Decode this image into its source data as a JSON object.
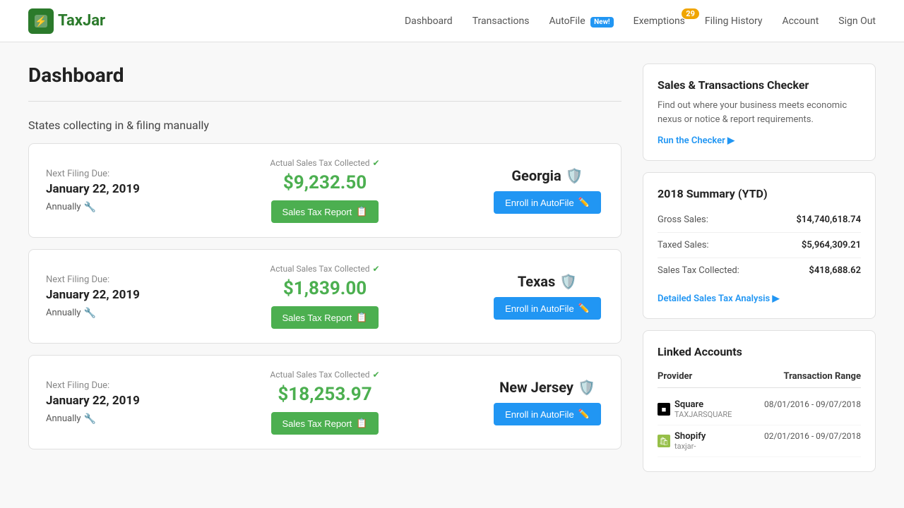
{
  "header": {
    "logo_text": "TaxJar",
    "logo_trademark": "®",
    "nav": {
      "items": [
        {
          "label": "Dashboard",
          "id": "dashboard",
          "badge": null,
          "new_badge": null
        },
        {
          "label": "Transactions",
          "id": "transactions",
          "badge": null,
          "new_badge": null
        },
        {
          "label": "AutoFile",
          "id": "autofile",
          "badge": null,
          "new_badge": "New!"
        },
        {
          "label": "Exemptions",
          "id": "exemptions",
          "badge": "29",
          "new_badge": null
        },
        {
          "label": "Filing History",
          "id": "filing-history",
          "badge": null,
          "new_badge": null
        },
        {
          "label": "Account",
          "id": "account",
          "badge": null,
          "new_badge": null
        },
        {
          "label": "Sign Out",
          "id": "sign-out",
          "badge": null,
          "new_badge": null
        }
      ]
    }
  },
  "main": {
    "title": "Dashboard",
    "section_title": "States collecting in & filing manually"
  },
  "state_cards": [
    {
      "id": "georgia",
      "next_filing_label": "Next Filing Due:",
      "next_filing_date": "January 22, 2019",
      "frequency": "Annually",
      "collected_label": "Actual Sales Tax Collected",
      "collected_amount": "$9,232.50",
      "report_btn": "Sales Tax Report",
      "state_name": "Georgia",
      "autofile_btn": "Enroll in AutoFile"
    },
    {
      "id": "texas",
      "next_filing_label": "Next Filing Due:",
      "next_filing_date": "January 22, 2019",
      "frequency": "Annually",
      "collected_label": "Actual Sales Tax Collected",
      "collected_amount": "$1,839.00",
      "report_btn": "Sales Tax Report",
      "state_name": "Texas",
      "autofile_btn": "Enroll in AutoFile"
    },
    {
      "id": "new-jersey",
      "next_filing_label": "Next Filing Due:",
      "next_filing_date": "January 22, 2019",
      "frequency": "Annually",
      "collected_label": "Actual Sales Tax Collected",
      "collected_amount": "$18,253.97",
      "report_btn": "Sales Tax Report",
      "state_name": "New Jersey",
      "autofile_btn": "Enroll in AutoFile"
    }
  ],
  "sidebar": {
    "checker": {
      "title": "Sales & Transactions Checker",
      "description": "Find out where your business meets economic nexus or notice & report requirements.",
      "link": "Run the Checker ▶"
    },
    "summary": {
      "title": "2018 Summary (YTD)",
      "rows": [
        {
          "label": "Gross Sales:",
          "value": "$14,740,618.74"
        },
        {
          "label": "Taxed Sales:",
          "value": "$5,964,309.21"
        },
        {
          "label": "Sales Tax Collected:",
          "value": "$418,688.62"
        }
      ],
      "link": "Detailed Sales Tax Analysis ▶"
    },
    "linked_accounts": {
      "title": "Linked Accounts",
      "header_provider": "Provider",
      "header_range": "Transaction Range",
      "accounts": [
        {
          "icon_type": "square",
          "provider": "Square",
          "sub": "TAXJARSQUARE",
          "range": "08/01/2016 - 09/07/2018"
        },
        {
          "icon_type": "shopify",
          "provider": "Shopify",
          "sub": "taxjar-",
          "range": "02/01/2016 - 09/07/2018"
        }
      ]
    }
  }
}
